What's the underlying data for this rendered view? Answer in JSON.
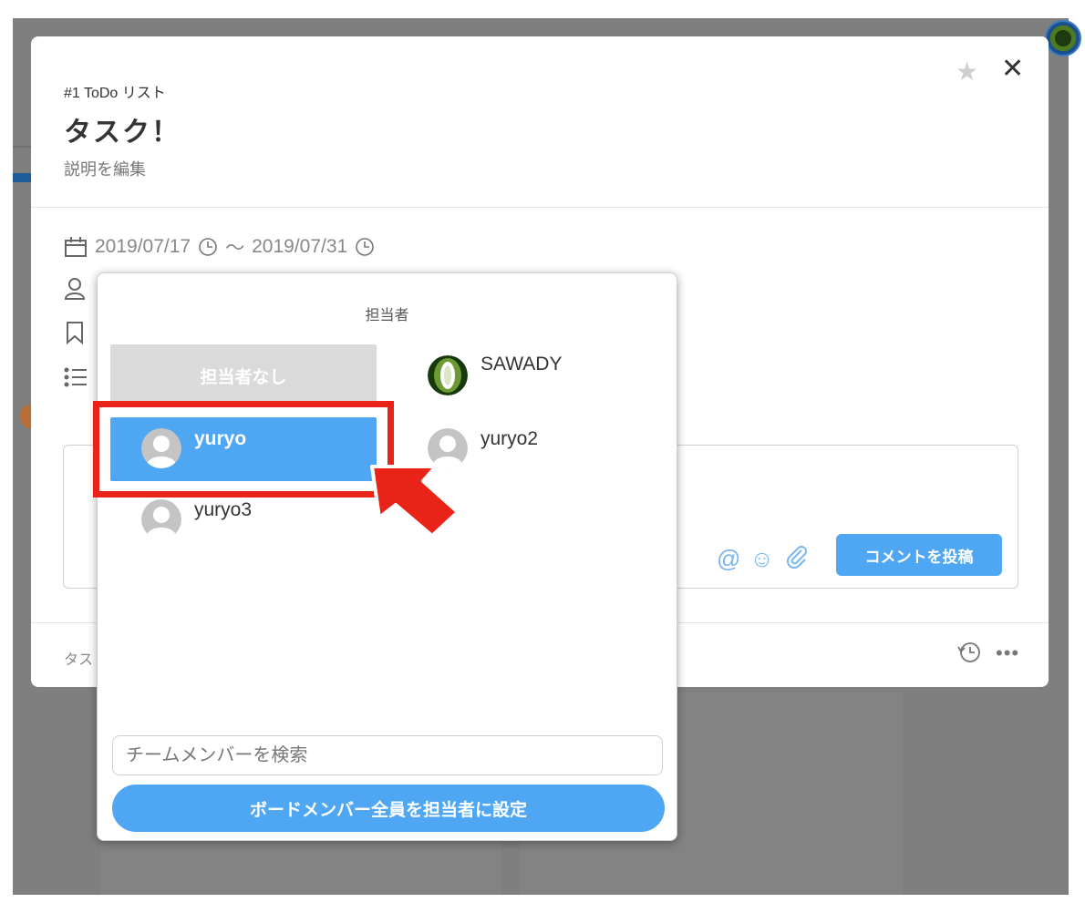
{
  "modal": {
    "breadcrumb": "#1 ToDo リスト",
    "title": "タスク！",
    "description_link": "説明を編集",
    "star_icon": "star-icon",
    "close_label": "✕",
    "start_date": "2019/07/17",
    "range_sep": "〜",
    "end_date": "2019/07/31",
    "comment_post_label": "コメントを投稿",
    "footer_text": "タス"
  },
  "assignee_picker": {
    "title": "担当者",
    "none_label": "担当者なし",
    "members": [
      {
        "name": "SAWADY",
        "avatar": "photo"
      },
      {
        "name": "yuryo",
        "avatar": "default",
        "selected": true
      },
      {
        "name": "yuryo2",
        "avatar": "default"
      },
      {
        "name": "yuryo3",
        "avatar": "default"
      }
    ],
    "search_placeholder": "チームメンバーを検索",
    "set_all_label": "ボードメンバー全員を担当者に設定"
  },
  "colors": {
    "accent": "#4fa7f4",
    "highlight": "#ea2319",
    "backdrop": "#7f7f7f"
  }
}
